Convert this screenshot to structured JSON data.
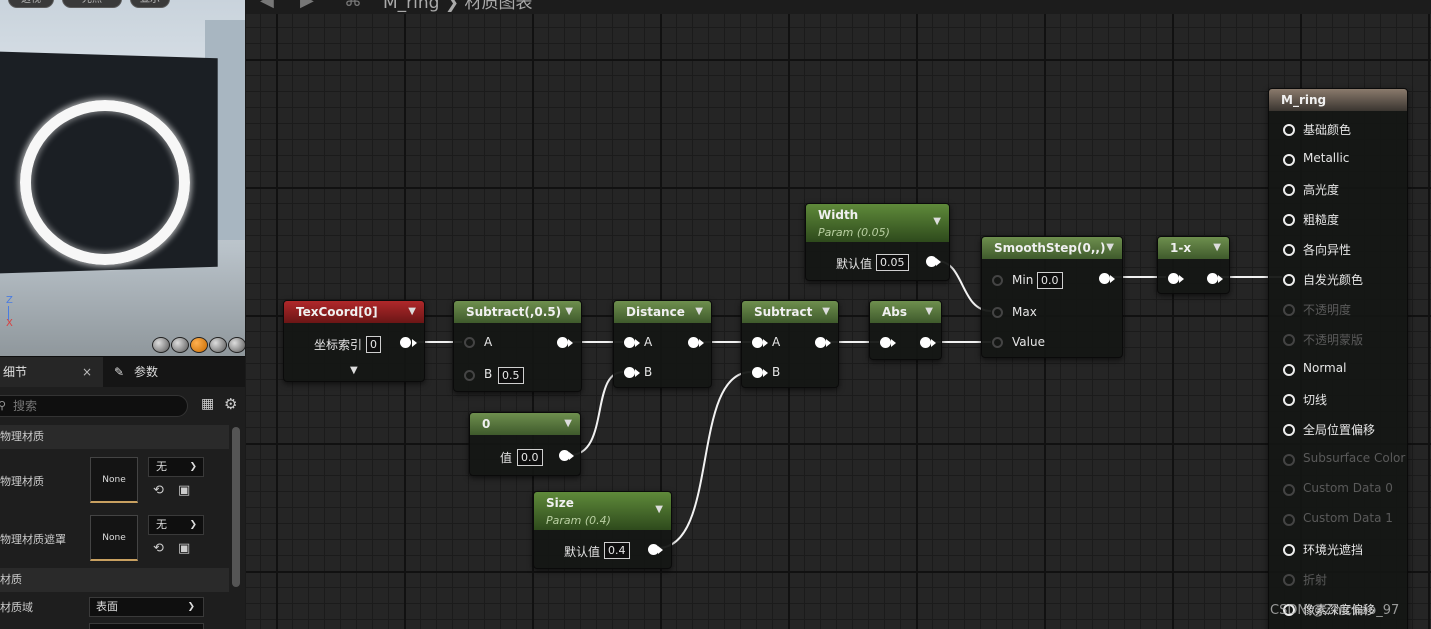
{
  "toolbar": {
    "back_icon": "arrow-left-icon",
    "forward_icon": "arrow-right-icon",
    "breadcrumb": "M_ring ❯ 材质图表"
  },
  "viewport": {
    "top_buttons": [
      "透视",
      "光照",
      "显示"
    ],
    "axes": {
      "z": "Z",
      "x": "X"
    }
  },
  "details": {
    "tab_details": "细节",
    "tab_close": "×",
    "tab_params": "参数",
    "search_placeholder": "搜索",
    "category_physical": "物理材质",
    "row_phys_material": "物理材质",
    "row_phys_mask": "物理材质遮罩",
    "thumb_none_1": "None",
    "thumb_none_2": "None",
    "combo_none_1": "无",
    "combo_none_2": "无",
    "category_material": "材质",
    "row_domain": "材质域",
    "domain_value": "表面"
  },
  "graph": {
    "texcoord": {
      "title": "TexCoord[0]",
      "index_label": "坐标索引",
      "index_value": "0"
    },
    "subtract1": {
      "title": "Subtract(,0.5)",
      "a": "A",
      "b": "B",
      "b_value": "0.5"
    },
    "const0": {
      "title": "0",
      "value_label": "值",
      "value": "0.0"
    },
    "distance": {
      "title": "Distance",
      "a": "A",
      "b": "B"
    },
    "size": {
      "title": "Size",
      "subtitle": "Param (0.4)",
      "default_label": "默认值",
      "default_value": "0.4"
    },
    "subtract2": {
      "title": "Subtract",
      "a": "A",
      "b": "B"
    },
    "abs": {
      "title": "Abs"
    },
    "width": {
      "title": "Width",
      "subtitle": "Param (0.05)",
      "default_label": "默认值",
      "default_value": "0.05"
    },
    "smoothstep": {
      "title": "SmoothStep(0,,)",
      "min": "Min",
      "min_value": "0.0",
      "max": "Max",
      "value": "Value"
    },
    "oneminus": {
      "title": "1-x"
    },
    "output": {
      "title": "M_ring",
      "pins": [
        {
          "label": "基础颜色",
          "enabled": true
        },
        {
          "label": "Metallic",
          "enabled": true
        },
        {
          "label": "高光度",
          "enabled": true
        },
        {
          "label": "粗糙度",
          "enabled": true
        },
        {
          "label": "各向异性",
          "enabled": true
        },
        {
          "label": "自发光颜色",
          "enabled": true
        },
        {
          "label": "不透明度",
          "enabled": false
        },
        {
          "label": "不透明蒙版",
          "enabled": false
        },
        {
          "label": "Normal",
          "enabled": true
        },
        {
          "label": "切线",
          "enabled": true
        },
        {
          "label": "全局位置偏移",
          "enabled": true
        },
        {
          "label": "Subsurface Color",
          "enabled": false
        },
        {
          "label": "Custom Data 0",
          "enabled": false
        },
        {
          "label": "Custom Data 1",
          "enabled": false
        },
        {
          "label": "环境光遮挡",
          "enabled": true
        },
        {
          "label": "折射",
          "enabled": false
        },
        {
          "label": "像素深度偏移",
          "enabled": true
        }
      ]
    }
  },
  "watermark": "CSDN @Zhichao_97"
}
